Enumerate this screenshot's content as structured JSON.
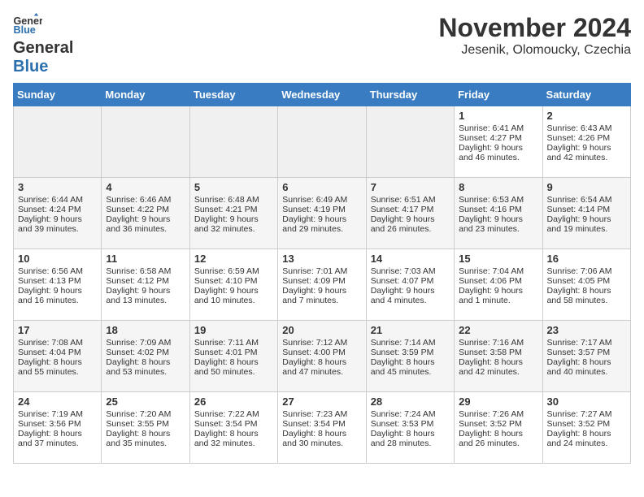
{
  "logo": {
    "general": "General",
    "blue": "Blue"
  },
  "header": {
    "month": "November 2024",
    "location": "Jesenik, Olomoucky, Czechia"
  },
  "days_of_week": [
    "Sunday",
    "Monday",
    "Tuesday",
    "Wednesday",
    "Thursday",
    "Friday",
    "Saturday"
  ],
  "weeks": [
    [
      {
        "day": "",
        "info": ""
      },
      {
        "day": "",
        "info": ""
      },
      {
        "day": "",
        "info": ""
      },
      {
        "day": "",
        "info": ""
      },
      {
        "day": "",
        "info": ""
      },
      {
        "day": "1",
        "info": "Sunrise: 6:41 AM\nSunset: 4:27 PM\nDaylight: 9 hours and 46 minutes."
      },
      {
        "day": "2",
        "info": "Sunrise: 6:43 AM\nSunset: 4:26 PM\nDaylight: 9 hours and 42 minutes."
      }
    ],
    [
      {
        "day": "3",
        "info": "Sunrise: 6:44 AM\nSunset: 4:24 PM\nDaylight: 9 hours and 39 minutes."
      },
      {
        "day": "4",
        "info": "Sunrise: 6:46 AM\nSunset: 4:22 PM\nDaylight: 9 hours and 36 minutes."
      },
      {
        "day": "5",
        "info": "Sunrise: 6:48 AM\nSunset: 4:21 PM\nDaylight: 9 hours and 32 minutes."
      },
      {
        "day": "6",
        "info": "Sunrise: 6:49 AM\nSunset: 4:19 PM\nDaylight: 9 hours and 29 minutes."
      },
      {
        "day": "7",
        "info": "Sunrise: 6:51 AM\nSunset: 4:17 PM\nDaylight: 9 hours and 26 minutes."
      },
      {
        "day": "8",
        "info": "Sunrise: 6:53 AM\nSunset: 4:16 PM\nDaylight: 9 hours and 23 minutes."
      },
      {
        "day": "9",
        "info": "Sunrise: 6:54 AM\nSunset: 4:14 PM\nDaylight: 9 hours and 19 minutes."
      }
    ],
    [
      {
        "day": "10",
        "info": "Sunrise: 6:56 AM\nSunset: 4:13 PM\nDaylight: 9 hours and 16 minutes."
      },
      {
        "day": "11",
        "info": "Sunrise: 6:58 AM\nSunset: 4:12 PM\nDaylight: 9 hours and 13 minutes."
      },
      {
        "day": "12",
        "info": "Sunrise: 6:59 AM\nSunset: 4:10 PM\nDaylight: 9 hours and 10 minutes."
      },
      {
        "day": "13",
        "info": "Sunrise: 7:01 AM\nSunset: 4:09 PM\nDaylight: 9 hours and 7 minutes."
      },
      {
        "day": "14",
        "info": "Sunrise: 7:03 AM\nSunset: 4:07 PM\nDaylight: 9 hours and 4 minutes."
      },
      {
        "day": "15",
        "info": "Sunrise: 7:04 AM\nSunset: 4:06 PM\nDaylight: 9 hours and 1 minute."
      },
      {
        "day": "16",
        "info": "Sunrise: 7:06 AM\nSunset: 4:05 PM\nDaylight: 8 hours and 58 minutes."
      }
    ],
    [
      {
        "day": "17",
        "info": "Sunrise: 7:08 AM\nSunset: 4:04 PM\nDaylight: 8 hours and 55 minutes."
      },
      {
        "day": "18",
        "info": "Sunrise: 7:09 AM\nSunset: 4:02 PM\nDaylight: 8 hours and 53 minutes."
      },
      {
        "day": "19",
        "info": "Sunrise: 7:11 AM\nSunset: 4:01 PM\nDaylight: 8 hours and 50 minutes."
      },
      {
        "day": "20",
        "info": "Sunrise: 7:12 AM\nSunset: 4:00 PM\nDaylight: 8 hours and 47 minutes."
      },
      {
        "day": "21",
        "info": "Sunrise: 7:14 AM\nSunset: 3:59 PM\nDaylight: 8 hours and 45 minutes."
      },
      {
        "day": "22",
        "info": "Sunrise: 7:16 AM\nSunset: 3:58 PM\nDaylight: 8 hours and 42 minutes."
      },
      {
        "day": "23",
        "info": "Sunrise: 7:17 AM\nSunset: 3:57 PM\nDaylight: 8 hours and 40 minutes."
      }
    ],
    [
      {
        "day": "24",
        "info": "Sunrise: 7:19 AM\nSunset: 3:56 PM\nDaylight: 8 hours and 37 minutes."
      },
      {
        "day": "25",
        "info": "Sunrise: 7:20 AM\nSunset: 3:55 PM\nDaylight: 8 hours and 35 minutes."
      },
      {
        "day": "26",
        "info": "Sunrise: 7:22 AM\nSunset: 3:54 PM\nDaylight: 8 hours and 32 minutes."
      },
      {
        "day": "27",
        "info": "Sunrise: 7:23 AM\nSunset: 3:54 PM\nDaylight: 8 hours and 30 minutes."
      },
      {
        "day": "28",
        "info": "Sunrise: 7:24 AM\nSunset: 3:53 PM\nDaylight: 8 hours and 28 minutes."
      },
      {
        "day": "29",
        "info": "Sunrise: 7:26 AM\nSunset: 3:52 PM\nDaylight: 8 hours and 26 minutes."
      },
      {
        "day": "30",
        "info": "Sunrise: 7:27 AM\nSunset: 3:52 PM\nDaylight: 8 hours and 24 minutes."
      }
    ]
  ]
}
